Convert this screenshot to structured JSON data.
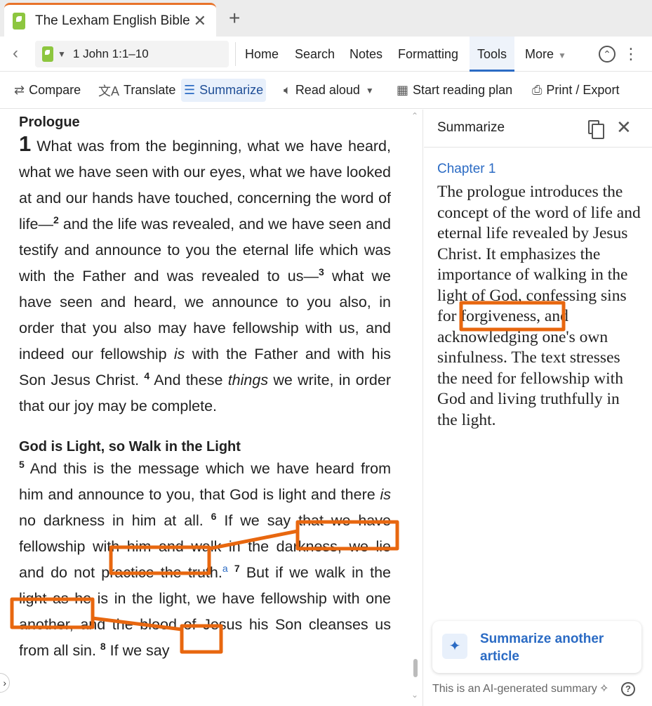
{
  "tab": {
    "title": "The Lexham English Bible",
    "close_glyph": "✕",
    "add_glyph": "+"
  },
  "nav": {
    "back_glyph": "‹",
    "reference": "1 John 1:1–10",
    "items": [
      "Home",
      "Search",
      "Notes",
      "Formatting",
      "Tools",
      "More"
    ],
    "active": "Tools"
  },
  "toolbar": {
    "compare": "Compare",
    "translate": "Translate",
    "summarize": "Summarize",
    "read_aloud": "Read aloud",
    "reading_plan": "Start reading plan",
    "print": "Print / Export"
  },
  "reader": {
    "heading1": "Prologue",
    "chapter": "1",
    "v1": " What was from the beginning, what we have heard, what we have seen with our eyes, what we have looked at and our hands have touched, con­cerning the word of life—",
    "n2": "2",
    "v2": " and the life was revealed, and we have seen and testify and announce to you the eternal life which was with the Father and was revealed to us—",
    "n3": "3",
    "v3a": " what we have seen and heard, we announce to you also, in order that you also may have fellowship with us, and indeed our fellowship ",
    "v3_is": "is",
    "v3b": " with the Father and with his Son Jesus Christ. ",
    "n4": "4",
    "v4a": " And these ",
    "v4_things": "things",
    "v4b": " we write, in order that our joy may be complete.",
    "heading2": "God is Light, so Walk in the Light",
    "n5": "5",
    "v5a": " And this is the message which we have heard from him and announce to you, that ",
    "v5_god_light": "God is light",
    "v5b": " and there ",
    "v5_is": "is",
    "v5_no_darkness": "no darkness",
    "v5c": " in him at all. ",
    "n6": "6",
    "v6a": " If we say that we have fellowship with him and walk in the ",
    "v6_darkness": "darkness",
    "v6b": " we lie and do not practice the truth.",
    "fn_a": "a",
    "n7": "7",
    "v7a": " But if we walk in the ",
    "v7_light": "light",
    "v7b": " as he is in the light, we have fellowship with one another, and the blood of Jesus his Son cleanses us from all sin. ",
    "n8": "8",
    "v8a": " If we say"
  },
  "panel": {
    "title": "Summarize",
    "chapter_label": "Chapter 1",
    "summary_a": "The prologue introduces the concept of the word of life and eternal life revealed by Jesus Christ. It emphasizes the importance of walking in the ",
    "summary_highlight": "light of God,",
    "summary_b": " confessing sins for forgiveness, and acknowledging one's own sinfulness. The text stresses the need for fellowship with God and living truthfully in the light.",
    "cta": "Summarize another article",
    "disclaimer": "This is an AI-generated summary"
  },
  "colors": {
    "accent": "#2b6bc4",
    "annotation": "#e8670f",
    "tab_highlight": "#e8732a"
  }
}
